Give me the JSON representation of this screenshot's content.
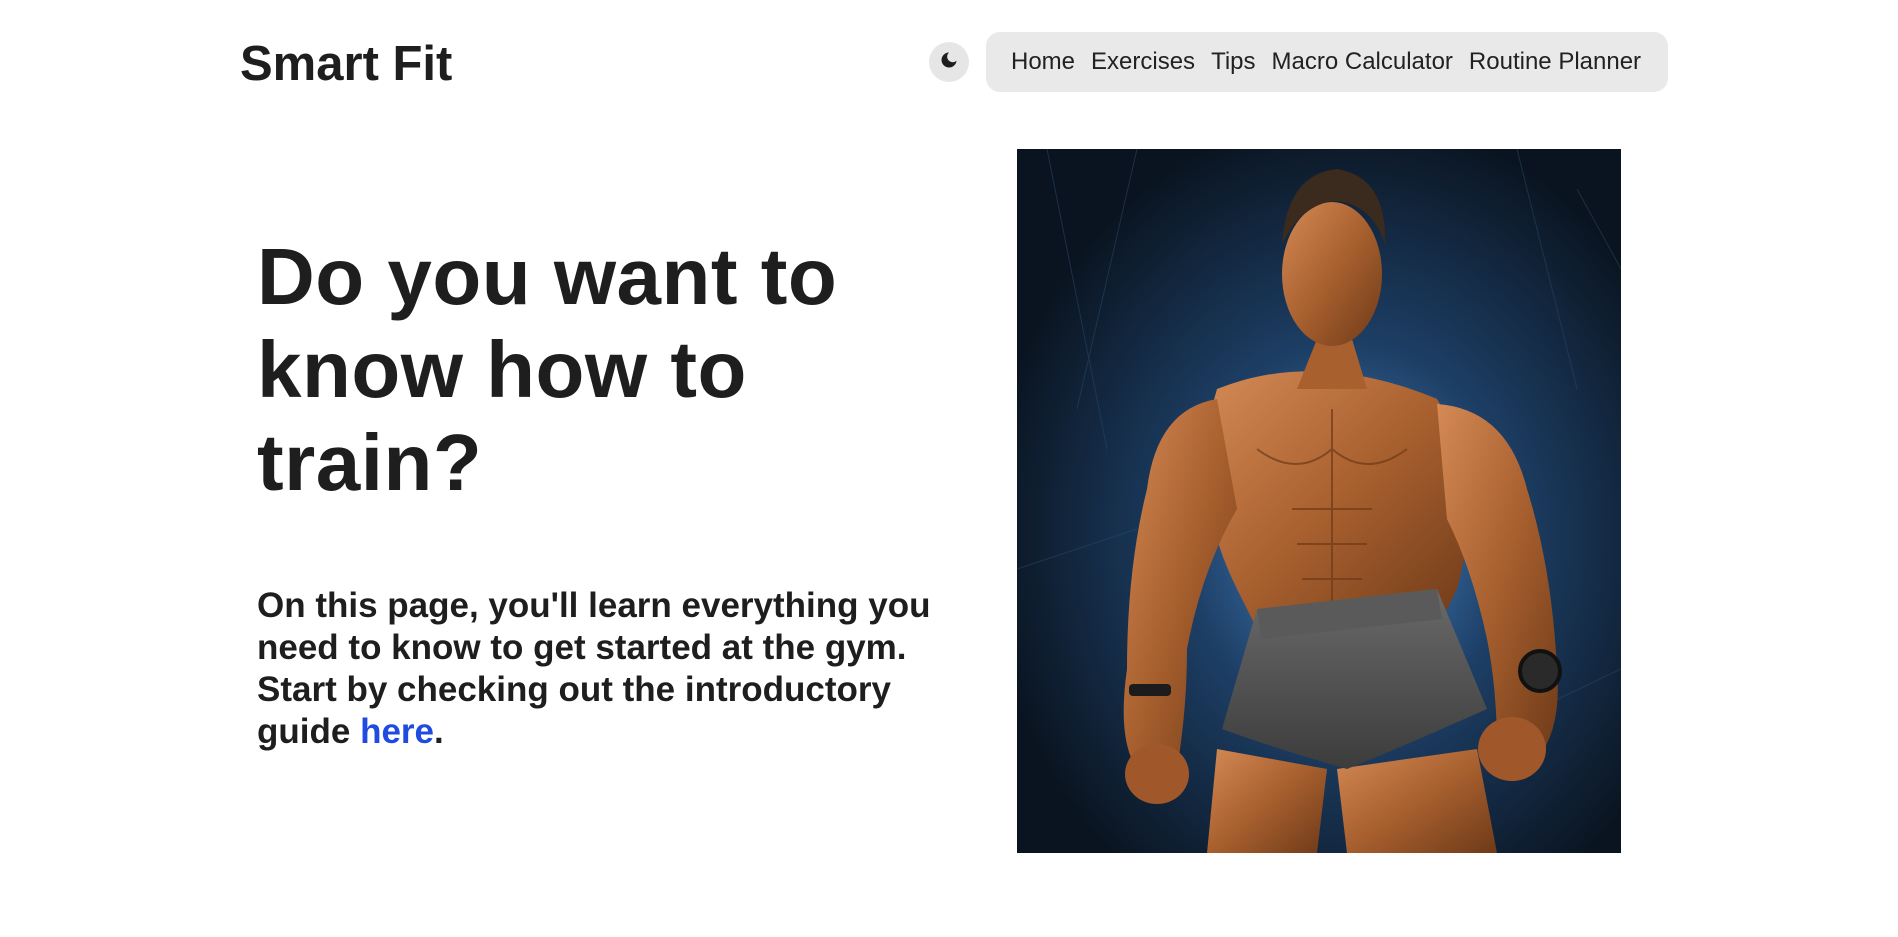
{
  "header": {
    "logo": "Smart Fit",
    "theme_toggle_icon": "moon-icon",
    "nav": [
      {
        "label": "Home"
      },
      {
        "label": "Exercises"
      },
      {
        "label": "Tips"
      },
      {
        "label": "Macro Calculator"
      },
      {
        "label": "Routine Planner"
      }
    ]
  },
  "hero": {
    "title": "Do you want to know how to train?",
    "description": "On this page, you'll learn everything you need to know to get started at the gym. Start by checking out the introductory guide ",
    "link_text": "here",
    "description_end": ".",
    "image_alt": "Muscular man posing"
  },
  "colors": {
    "text": "#1e1e1e",
    "link": "#1f4be0",
    "nav_bg": "#e9e9e9",
    "toggle_bg": "#e6e6e6"
  }
}
